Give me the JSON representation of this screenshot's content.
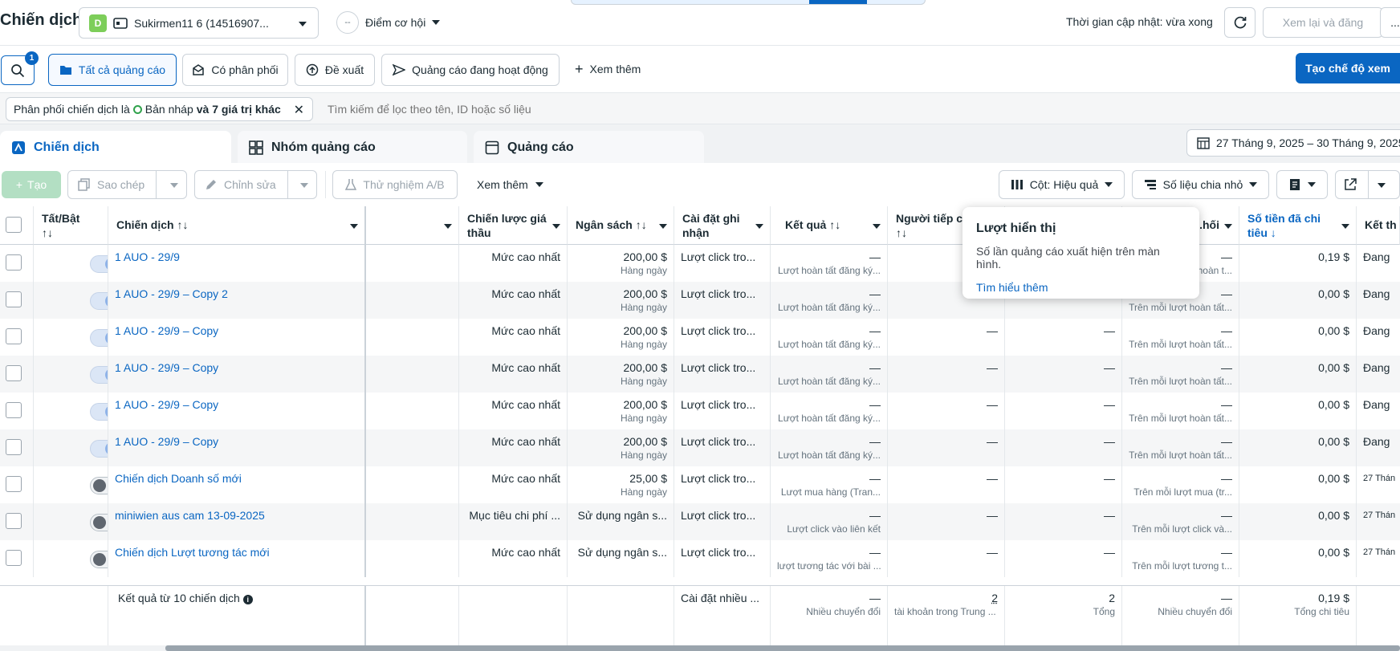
{
  "topbar": {
    "title": "Chiến dịch",
    "account_initial": "D",
    "account_name": "Sukirmen11 6 (14516907...",
    "opportunity_badge": "--",
    "opportunity_label": "Điểm cơ hội",
    "update_time": "Thời gian cập nhật: vừa xong",
    "review_publish": "Xem lại và đăng",
    "more": "..."
  },
  "nav": {
    "search_badge": "1",
    "items": [
      {
        "label": "Tất cả quảng cáo",
        "icon": "folder-icon"
      },
      {
        "label": "Có phân phối",
        "icon": "inbox-icon"
      },
      {
        "label": "Đề xuất",
        "icon": "arrow-up-circle-icon"
      },
      {
        "label": "Quảng cáo đang hoạt động",
        "icon": "send-icon"
      },
      {
        "label": "Xem thêm",
        "icon": "plus-icon"
      }
    ],
    "create_view": "Tạo chế độ xem"
  },
  "filter": {
    "chip_prefix": "Phân phối chiến dịch là",
    "chip_status": "Bản nháp",
    "chip_suffix": "và 7 giá trị khác",
    "search_placeholder": "Tìm kiếm để lọc theo tên, ID hoặc số liệu"
  },
  "tabs": [
    {
      "label": "Chiến dịch"
    },
    {
      "label": "Nhóm quảng cáo"
    },
    {
      "label": "Quảng cáo"
    }
  ],
  "date_range": "27 Tháng 9, 2025 – 30 Tháng 9, 2025",
  "toolbar": {
    "create": "Tạo",
    "copy": "Sao chép",
    "edit": "Chỉnh sửa",
    "ab_test": "Thử nghiệm A/B",
    "more": "Xem thêm",
    "columns": "Cột: Hiệu quả",
    "breakdown": "Số liệu chia nhỏ"
  },
  "columns": {
    "toggle": "Tất/Bật",
    "campaign": "Chiến dịch",
    "bid_strategy": "Chiến lược giá thầu",
    "budget": "Ngân sách",
    "attribution": "Cài đặt ghi nhận",
    "results": "Kết quả",
    "reach": "Người tiếp cận",
    "cost_per_result": "...hối",
    "amount_spent": "Số tiền đã chi tiêu",
    "ends": "Kết th"
  },
  "rows": [
    {
      "on": true,
      "name": "1 AUO - 29/9",
      "bid": "Mức cao nhất",
      "budget": "200,00 $",
      "budget_sub": "Hàng ngày",
      "attribution": "Lượt click tro...",
      "results": "—",
      "results_sub": "Lượt hoàn tất đăng ký...",
      "reach": "",
      "impressions": "",
      "cpr": "—",
      "cpr_sub": "...hoàn t...",
      "spent": "0,19 $",
      "ends": "Đang"
    },
    {
      "on": true,
      "name": "1 AUO - 29/9 – Copy 2",
      "bid": "Mức cao nhất",
      "budget": "200,00 $",
      "budget_sub": "Hàng ngày",
      "attribution": "Lượt click tro...",
      "results": "—",
      "results_sub": "Lượt hoàn tất đăng ký...",
      "reach": "",
      "impressions": "",
      "cpr": "—",
      "cpr_sub": "Trên mỗi lượt hoàn tất...",
      "spent": "0,00 $",
      "ends": "Đang"
    },
    {
      "on": true,
      "name": "1 AUO - 29/9 – Copy",
      "bid": "Mức cao nhất",
      "budget": "200,00 $",
      "budget_sub": "Hàng ngày",
      "attribution": "Lượt click tro...",
      "results": "—",
      "results_sub": "Lượt hoàn tất đăng ký...",
      "reach": "—",
      "impressions": "—",
      "cpr": "—",
      "cpr_sub": "Trên mỗi lượt hoàn tất...",
      "spent": "0,00 $",
      "ends": "Đang"
    },
    {
      "on": true,
      "name": "1 AUO - 29/9 – Copy",
      "bid": "Mức cao nhất",
      "budget": "200,00 $",
      "budget_sub": "Hàng ngày",
      "attribution": "Lượt click tro...",
      "results": "—",
      "results_sub": "Lượt hoàn tất đăng ký...",
      "reach": "—",
      "impressions": "—",
      "cpr": "—",
      "cpr_sub": "Trên mỗi lượt hoàn tất...",
      "spent": "0,00 $",
      "ends": "Đang"
    },
    {
      "on": true,
      "name": "1 AUO - 29/9 – Copy",
      "bid": "Mức cao nhất",
      "budget": "200,00 $",
      "budget_sub": "Hàng ngày",
      "attribution": "Lượt click tro...",
      "results": "—",
      "results_sub": "Lượt hoàn tất đăng ký...",
      "reach": "—",
      "impressions": "—",
      "cpr": "—",
      "cpr_sub": "Trên mỗi lượt hoàn tất...",
      "spent": "0,00 $",
      "ends": "Đang"
    },
    {
      "on": true,
      "name": "1 AUO - 29/9 – Copy",
      "bid": "Mức cao nhất",
      "budget": "200,00 $",
      "budget_sub": "Hàng ngày",
      "attribution": "Lượt click tro...",
      "results": "—",
      "results_sub": "Lượt hoàn tất đăng ký...",
      "reach": "—",
      "impressions": "—",
      "cpr": "—",
      "cpr_sub": "Trên mỗi lượt hoàn tất...",
      "spent": "0,00 $",
      "ends": "Đang"
    },
    {
      "on": false,
      "name": "Chiến dịch Doanh số mới",
      "bid": "Mức cao nhất",
      "budget": "25,00 $",
      "budget_sub": "Hàng ngày",
      "attribution": "Lượt click tro...",
      "results": "—",
      "results_sub": "Lượt mua hàng (Tran...",
      "reach": "—",
      "impressions": "—",
      "cpr": "—",
      "cpr_sub": "Trên mỗi lượt mua (tr...",
      "spent": "0,00 $",
      "ends": "27 Thán"
    },
    {
      "on": false,
      "name": "miniwien aus cam 13-09-2025",
      "bid": "Mục tiêu chi phí ...",
      "budget": "Sử dụng ngân s...",
      "budget_sub": "",
      "attribution": "Lượt click tro...",
      "results": "—",
      "results_sub": "Lượt click vào liên kết",
      "reach": "—",
      "impressions": "—",
      "cpr": "—",
      "cpr_sub": "Trên mỗi lượt click và...",
      "spent": "0,00 $",
      "ends": "27 Thán"
    },
    {
      "on": false,
      "name": "Chiến dịch Lượt tương tác mới",
      "bid": "Mức cao nhất",
      "budget": "Sử dụng ngân s...",
      "budget_sub": "",
      "attribution": "Lượt click tro...",
      "results": "—",
      "results_sub": "lượt tương tác với bài ...",
      "reach": "—",
      "impressions": "—",
      "cpr": "—",
      "cpr_sub": "Trên mỗi lượt tương t...",
      "spent": "0,00 $",
      "ends": "27 Thán"
    }
  ],
  "footer": {
    "summary": "Kết quả từ 10 chiến dịch",
    "attribution": "Cài đặt nhiều ...",
    "results": "—",
    "results_sub": "Nhiều chuyển đổi",
    "reach": "2",
    "reach_sub": "tài khoản trong Trung ...",
    "impressions": "2",
    "impressions_sub": "Tổng",
    "cpr": "—",
    "cpr_sub": "Nhiều chuyển đổi",
    "spent": "0,19 $",
    "spent_sub": "Tổng chi tiêu"
  },
  "tooltip": {
    "title": "Lượt hiển thị",
    "body": "Số lần quảng cáo xuất hiện trên màn hình.",
    "link": "Tìm hiểu thêm"
  },
  "colors": {
    "accent": "#0a66c2",
    "create_disabled": "#b3dfc3",
    "link": "#1877f2"
  }
}
